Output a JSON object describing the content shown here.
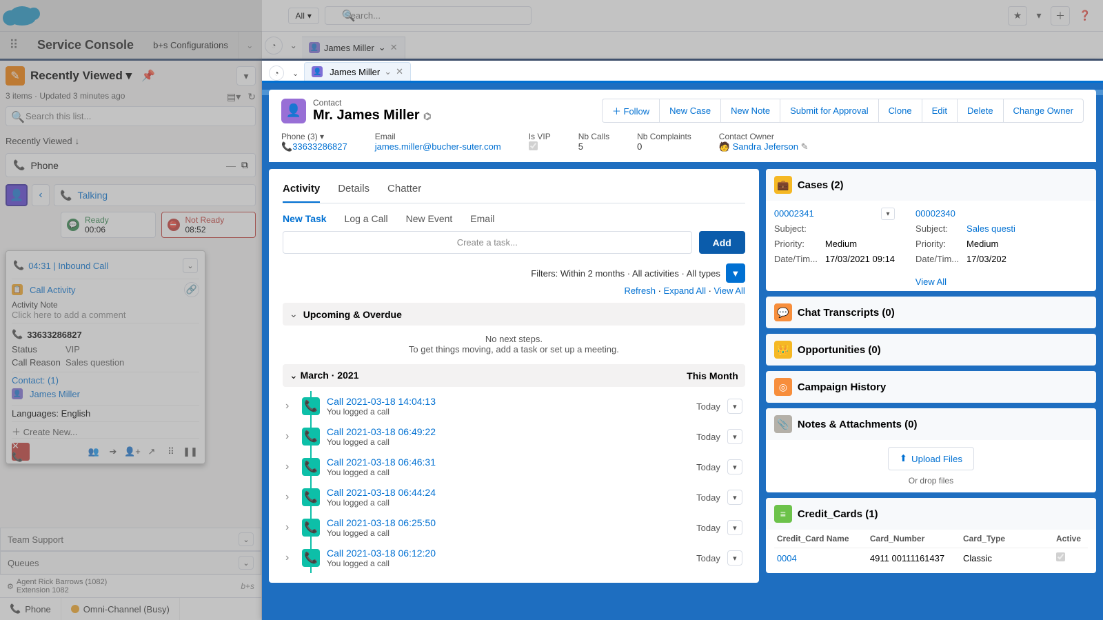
{
  "header": {
    "scope": "All",
    "search_placeholder": "Search..."
  },
  "appnav": {
    "app_name": "Service Console",
    "nav_item": "b+s Configurations",
    "tab_label": "James Miller"
  },
  "left": {
    "title": "Recently Viewed",
    "meta": "3 items · Updated 3 minutes ago",
    "search_placeholder": "Search this list...",
    "rv_link": "Recently Viewed",
    "phone_item": "Phone",
    "talking": "Talking",
    "ready": {
      "label": "Ready",
      "time": "00:06"
    },
    "not_ready": {
      "label": "Not Ready",
      "time": "08:52"
    }
  },
  "call": {
    "header": "04:31 | Inbound Call",
    "activity": "Call Activity",
    "note_label": "Activity Note",
    "note_placeholder": "Click here to add a comment",
    "phone": "33633286827",
    "status_k": "Status",
    "status_v": "VIP",
    "reason_k": "Call Reason",
    "reason_v": "Sales question",
    "contact_label": "Contact:  (1)",
    "contact_name": "James Miller",
    "lang": "Languages: English",
    "create": "Create New..."
  },
  "lb": {
    "team": "Team Support",
    "queues": "Queues",
    "agent_l1": "Agent Rick Barrows (1082)",
    "agent_l2": "Extension 1082",
    "util_phone": "Phone",
    "util_omni": "Omni-Channel (Busy)"
  },
  "focus_tab": "James Miller",
  "contact": {
    "type": "Contact",
    "name": "Mr. James Miller",
    "actions": {
      "follow": "Follow",
      "newcase": "New Case",
      "newnote": "New Note",
      "submit": "Submit for Approval",
      "clone": "Clone",
      "edit": "Edit",
      "delete": "Delete",
      "chown": "Change Owner"
    },
    "fields": {
      "phone_l": "Phone (3)",
      "phone_v": "33633286827",
      "email_l": "Email",
      "email_v": "james.miller@bucher-suter.com",
      "vip_l": "Is VIP",
      "calls_l": "Nb Calls",
      "calls_v": "5",
      "compl_l": "Nb Complaints",
      "compl_v": "0",
      "owner_l": "Contact Owner",
      "owner_v": "Sandra Jeferson"
    }
  },
  "tabs": {
    "activity": "Activity",
    "details": "Details",
    "chatter": "Chatter"
  },
  "subtabs": {
    "newtask": "New Task",
    "logcall": "Log a Call",
    "newevent": "New Event",
    "email": "Email"
  },
  "task": {
    "placeholder": "Create a task...",
    "add": "Add"
  },
  "filters": "Filters: Within 2 months · All activities · All types",
  "links": {
    "refresh": "Refresh",
    "expand": "Expand All",
    "viewall": "View All"
  },
  "upcoming": {
    "title": "Upcoming & Overdue",
    "l1": "No next steps.",
    "l2": "To get things moving, add a task or set up a meeting."
  },
  "month": {
    "title": "March · 2021",
    "when": "This Month"
  },
  "timeline": [
    {
      "title": "Call 2021-03-18 14:04:13",
      "sub": "You logged a call",
      "when": "Today"
    },
    {
      "title": "Call 2021-03-18 06:49:22",
      "sub": "You logged a call",
      "when": "Today"
    },
    {
      "title": "Call 2021-03-18 06:46:31",
      "sub": "You logged a call",
      "when": "Today"
    },
    {
      "title": "Call 2021-03-18 06:44:24",
      "sub": "You logged a call",
      "when": "Today"
    },
    {
      "title": "Call 2021-03-18 06:25:50",
      "sub": "You logged a call",
      "when": "Today"
    },
    {
      "title": "Call 2021-03-18 06:12:20",
      "sub": "You logged a call",
      "when": "Today"
    }
  ],
  "cards": {
    "cases": {
      "title": "Cases (2)",
      "left": {
        "num": "00002341",
        "subj_l": "Subject:",
        "subj_v": "",
        "pri_l": "Priority:",
        "pri_v": "Medium",
        "dt_l": "Date/Tim...",
        "dt_v": "17/03/2021 09:14"
      },
      "right": {
        "num": "00002340",
        "subj_l": "Subject:",
        "subj_v": "Sales questi",
        "pri_l": "Priority:",
        "pri_v": "Medium",
        "dt_l": "Date/Tim...",
        "dt_v": "17/03/202"
      },
      "viewall": "View All"
    },
    "chat": "Chat Transcripts (0)",
    "opp": "Opportunities (0)",
    "camp": "Campaign History",
    "notes": {
      "title": "Notes & Attachments (0)",
      "upload": "Upload Files",
      "drop": "Or drop files"
    },
    "cc": {
      "title": "Credit_Cards (1)",
      "h1": "Credit_Card Name",
      "h2": "Card_Number",
      "h3": "Card_Type",
      "h4": "Active",
      "name": "0004",
      "num": "4911 00111161437",
      "type": "Classic"
    }
  }
}
